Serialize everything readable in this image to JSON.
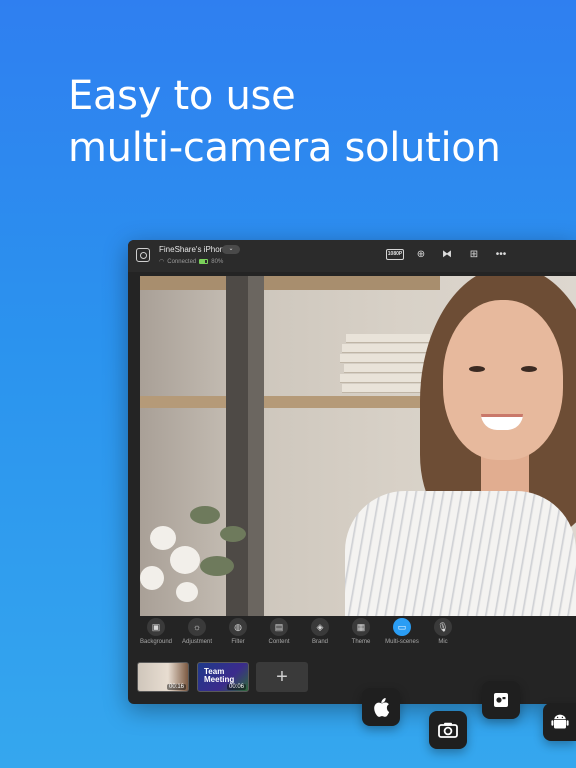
{
  "headline": {
    "line1": "Easy to use",
    "line2": "multi-camera solution"
  },
  "window": {
    "device_name": "FineShare's iPhone",
    "dropdown_icon": "chevron-down-icon",
    "status": "Connected",
    "battery": "80%",
    "resolution": "1080P",
    "toolbar_icons": [
      "zoom-icon",
      "mirror-icon",
      "layout-icon",
      "more-icon"
    ]
  },
  "tools": [
    {
      "label": "Background",
      "icon": "image-icon"
    },
    {
      "label": "Adjustment",
      "icon": "sun-icon"
    },
    {
      "label": "Filter",
      "icon": "filter-icon"
    },
    {
      "label": "Content",
      "icon": "content-icon"
    },
    {
      "label": "Brand",
      "icon": "tag-icon"
    },
    {
      "label": "Theme",
      "icon": "theme-icon"
    },
    {
      "label": "Multi-scenes",
      "icon": "scenes-icon",
      "active": true
    },
    {
      "label": "Mic",
      "icon": "mic-icon"
    }
  ],
  "scenes": [
    {
      "duration": "00:16"
    },
    {
      "title_line1": "Team",
      "title_line2": "Meeting",
      "duration": "00:06"
    }
  ],
  "add_scene_label": "+",
  "platform_badges": [
    "apple-icon",
    "camera-icon",
    "windows-camera-icon",
    "android-icon"
  ],
  "colors": {
    "accent": "#2a9df4",
    "background_top": "#2f7ff0",
    "background_bottom": "#35a7ee",
    "window_bg": "#242424"
  }
}
